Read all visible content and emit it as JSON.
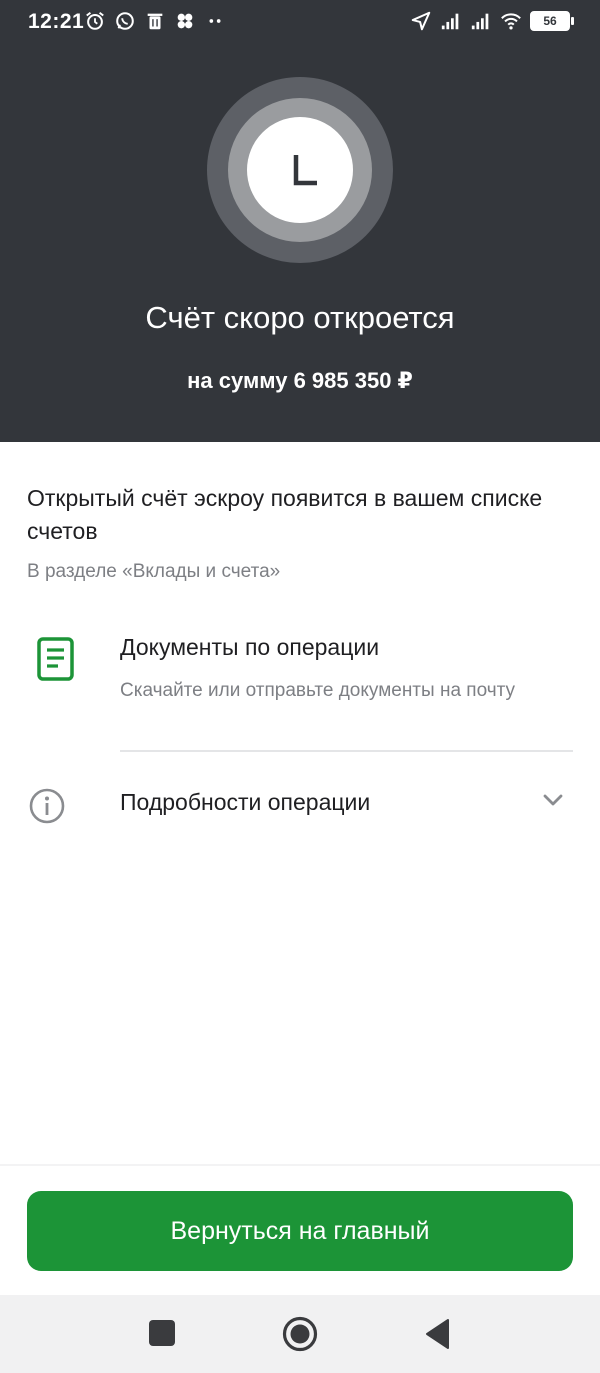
{
  "status_bar": {
    "time": "12:21",
    "battery": "56",
    "icons_left": [
      "alarm-icon",
      "whatsapp-icon",
      "trash-icon",
      "apps-icon",
      "more-dots-icon"
    ],
    "icons_right": [
      "location-arrow-icon",
      "signal-icon",
      "signal-icon",
      "wifi-icon",
      "battery-icon"
    ]
  },
  "hero": {
    "icon": "clock-icon",
    "title": "Счёт скоро откроется",
    "amount_text": "на сумму 6 985 350 ₽"
  },
  "info": {
    "title": "Открытый счёт эскроу появится в вашем списке счетов",
    "subtitle": "В разделе «Вклады и счета»"
  },
  "documents": {
    "icon": "document-icon",
    "title": "Документы по операции",
    "subtitle": "Скачайте или отправьте документы на почту"
  },
  "details": {
    "icon": "info-icon",
    "title": "Подробности операции",
    "expand_icon": "chevron-down-icon"
  },
  "actions": {
    "home_button_label": "Вернуться на главный"
  },
  "nav_bar": {
    "buttons": [
      "recent-apps-icon",
      "home-icon",
      "back-icon"
    ]
  },
  "colors": {
    "hero_background": "#33363b",
    "accent_green": "#1c9437",
    "secondary_text": "#7d7f84"
  }
}
